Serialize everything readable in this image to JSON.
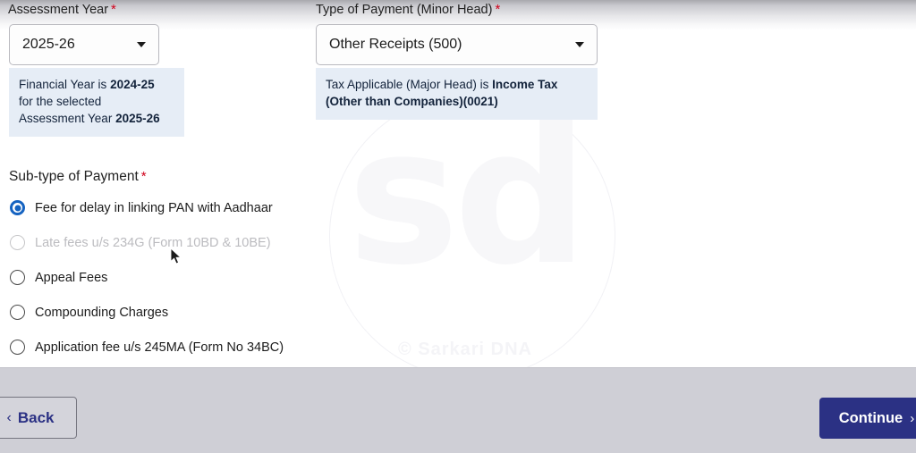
{
  "form": {
    "assessment_year": {
      "label": "Assessment Year",
      "required_mark": "*",
      "selected": "2025-26",
      "caret_icon": "chevron-down-icon",
      "hint_line1_prefix": "Financial Year is ",
      "hint_line1_bold": "2024-25",
      "hint_line2": "for the selected",
      "hint_line3_prefix": "Assessment Year ",
      "hint_line3_bold": "2025-26"
    },
    "payment_type": {
      "label": "Type of Payment (Minor Head)",
      "required_mark": "*",
      "selected": "Other Receipts (500)",
      "caret_icon": "chevron-down-icon",
      "hint_prefix": "Tax Applicable (Major Head) is ",
      "hint_bold": "Income Tax (Other than Companies)(0021)"
    },
    "sub_type": {
      "label": "Sub-type of Payment",
      "required_mark": "*",
      "options": [
        {
          "label": "Fee for delay in linking PAN with Aadhaar",
          "selected": true,
          "disabled": false
        },
        {
          "label": "Late fees u/s 234G (Form 10BD & 10BE)",
          "selected": false,
          "disabled": true
        },
        {
          "label": "Appeal Fees",
          "selected": false,
          "disabled": false
        },
        {
          "label": "Compounding Charges",
          "selected": false,
          "disabled": false
        },
        {
          "label": "Application fee u/s 245MA (Form No 34BC)",
          "selected": false,
          "disabled": false
        }
      ]
    }
  },
  "footer": {
    "back_label": "Back",
    "back_chevron": "‹",
    "continue_label": "Continue",
    "continue_chevron": "›"
  },
  "watermark": {
    "letters": "sd",
    "credit": "© Sarkari DNA"
  },
  "colors": {
    "accent_navy": "#2b3184",
    "radio_blue": "#1563c1",
    "required_red": "#d0021b",
    "info_bg": "#e6edf6",
    "footer_bg": "#cfcfd6"
  }
}
